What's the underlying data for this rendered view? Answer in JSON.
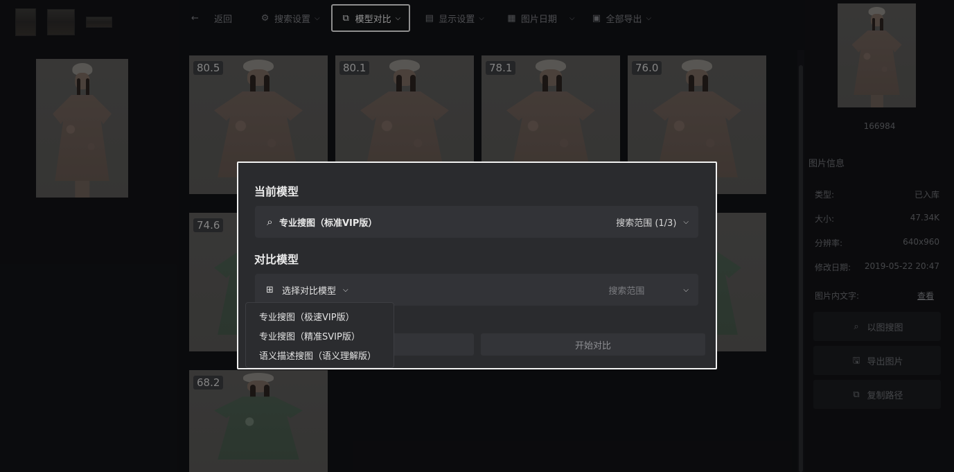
{
  "toolbar": {
    "back": "返回",
    "search_settings": "搜索设置",
    "model_compare": "模型对比",
    "display_settings": "显示设置",
    "image_date": "图片日期",
    "export_all": "全部导出"
  },
  "results": [
    {
      "score": "80.5",
      "style": "pink"
    },
    {
      "score": "80.1",
      "style": "pink"
    },
    {
      "score": "78.1",
      "style": "pink"
    },
    {
      "score": "76.0",
      "style": "pink"
    },
    {
      "score": "74.6",
      "style": "green"
    },
    {
      "score": "68.2",
      "style": "green"
    }
  ],
  "right_panel": {
    "image_id": "166984",
    "info_title": "图片信息",
    "rows": [
      {
        "label": "类型:",
        "value": "已入库"
      },
      {
        "label": "大小:",
        "value": "47.34K"
      },
      {
        "label": "分辨率:",
        "value": "640x960"
      },
      {
        "label": "修改日期:",
        "value": "2019-05-22 20:47"
      }
    ],
    "text_in_image_label": "图片内文字:",
    "text_in_image_link": "查看",
    "buttons": {
      "search_by_image": "以图搜图",
      "export_image": "导出图片",
      "copy_path": "复制路径"
    }
  },
  "modal": {
    "current_model_title": "当前模型",
    "current_model_name": "专业搜图（标准VIP版）",
    "current_scope": "搜索范围 (1/3)",
    "compare_model_title": "对比模型",
    "select_compare_model": "选择对比模型",
    "compare_scope_placeholder": "搜索范围",
    "start_compare": "开始对比"
  },
  "dropdown": {
    "options": [
      "专业搜图（极速VIP版）",
      "专业搜图（精准SVIP版）",
      "语义描述搜图（语义理解版）"
    ]
  }
}
